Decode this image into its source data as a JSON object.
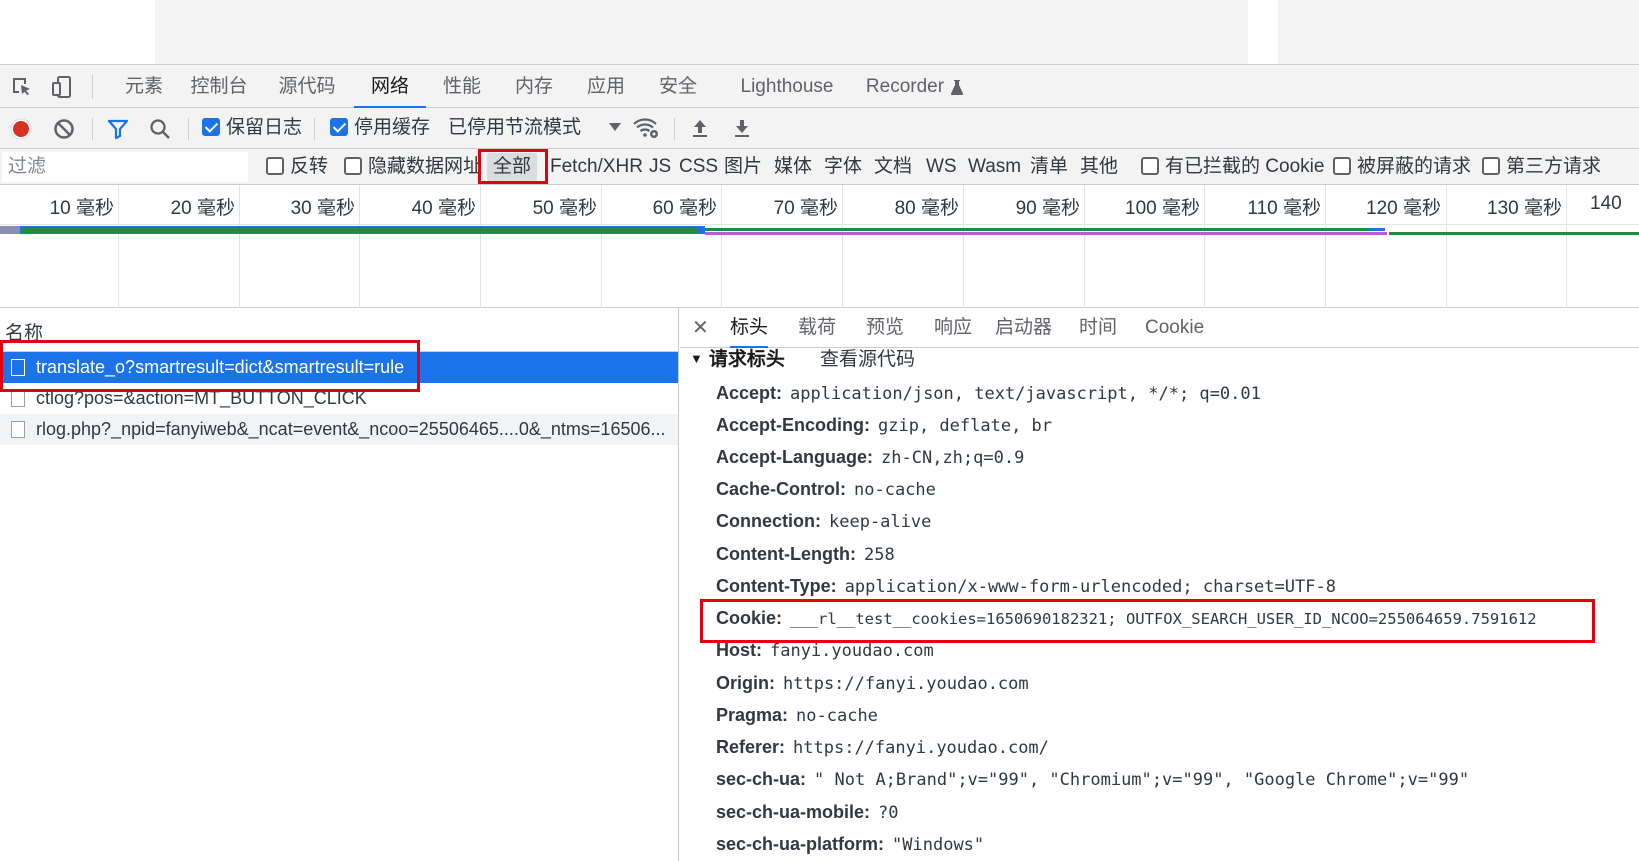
{
  "devtools": {
    "main_tabs": [
      {
        "label": "元素"
      },
      {
        "label": "控制台"
      },
      {
        "label": "源代码"
      },
      {
        "label": "网络",
        "active": true
      },
      {
        "label": "性能"
      },
      {
        "label": "内存"
      },
      {
        "label": "应用"
      },
      {
        "label": "安全"
      },
      {
        "label": "Lighthouse"
      },
      {
        "label": "Recorder"
      }
    ]
  },
  "toolbar": {
    "preserve_log": {
      "label": "保留日志",
      "checked": true
    },
    "disable_cache": {
      "label": "停用缓存",
      "checked": true
    },
    "throttle": "已停用节流模式"
  },
  "filter": {
    "placeholder": "过滤",
    "invert": "反转",
    "hide_data_urls": "隐藏数据网址",
    "types": [
      "全部",
      "Fetch/XHR",
      "JS",
      "CSS",
      "图片",
      "媒体",
      "字体",
      "文档",
      "WS",
      "Wasm",
      "清单",
      "其他"
    ],
    "blocked_cookies": "有已拦截的 Cookie",
    "blocked_requests": "被屏蔽的请求",
    "third_party": "第三方请求"
  },
  "timeline": {
    "ticks": [
      "10 毫秒",
      "20 毫秒",
      "30 毫秒",
      "40 毫秒",
      "50 毫秒",
      "60 毫秒",
      "70 毫秒",
      "80 毫秒",
      "90 毫秒",
      "100 毫秒",
      "110 毫秒",
      "120 毫秒",
      "130 毫秒",
      "140"
    ]
  },
  "requests": {
    "column_name": "名称",
    "items": [
      {
        "name": "translate_o?smartresult=dict&smartresult=rule",
        "selected": true
      },
      {
        "name": "ctlog?pos=&action=MT_BUTTON_CLICK"
      },
      {
        "name": "rlog.php?_npid=fanyiweb&_ncat=event&_ncoo=25506465....0&_ntms=16506..."
      }
    ]
  },
  "details": {
    "tabs": [
      "标头",
      "载荷",
      "预览",
      "响应",
      "启动器",
      "时间",
      "Cookie"
    ],
    "section_title": "请求标头",
    "view_source": "查看源代码",
    "headers": [
      {
        "k": "Accept:",
        "v": "application/json, text/javascript, */*; q=0.01"
      },
      {
        "k": "Accept-Encoding:",
        "v": "gzip, deflate, br"
      },
      {
        "k": "Accept-Language:",
        "v": "zh-CN,zh;q=0.9"
      },
      {
        "k": "Cache-Control:",
        "v": "no-cache"
      },
      {
        "k": "Connection:",
        "v": "keep-alive"
      },
      {
        "k": "Content-Length:",
        "v": "258"
      },
      {
        "k": "Content-Type:",
        "v": "application/x-www-form-urlencoded; charset=UTF-8"
      },
      {
        "k": "Cookie:",
        "v": "___rl__test__cookies=1650690182321; OUTFOX_SEARCH_USER_ID_NCOO=255064659.7591612"
      },
      {
        "k": "Host:",
        "v": "fanyi.youdao.com"
      },
      {
        "k": "Origin:",
        "v": "https://fanyi.youdao.com"
      },
      {
        "k": "Pragma:",
        "v": "no-cache"
      },
      {
        "k": "Referer:",
        "v": "https://fanyi.youdao.com/"
      },
      {
        "k": "sec-ch-ua:",
        "v": "\" Not A;Brand\";v=\"99\", \"Chromium\";v=\"99\", \"Google Chrome\";v=\"99\""
      },
      {
        "k": "sec-ch-ua-mobile:",
        "v": "?0"
      },
      {
        "k": "sec-ch-ua-platform:",
        "v": "\"Windows\""
      }
    ]
  },
  "colors": {
    "accent": "#1a73e8",
    "highlight_box": "#e3000f",
    "record": "#d93025"
  }
}
